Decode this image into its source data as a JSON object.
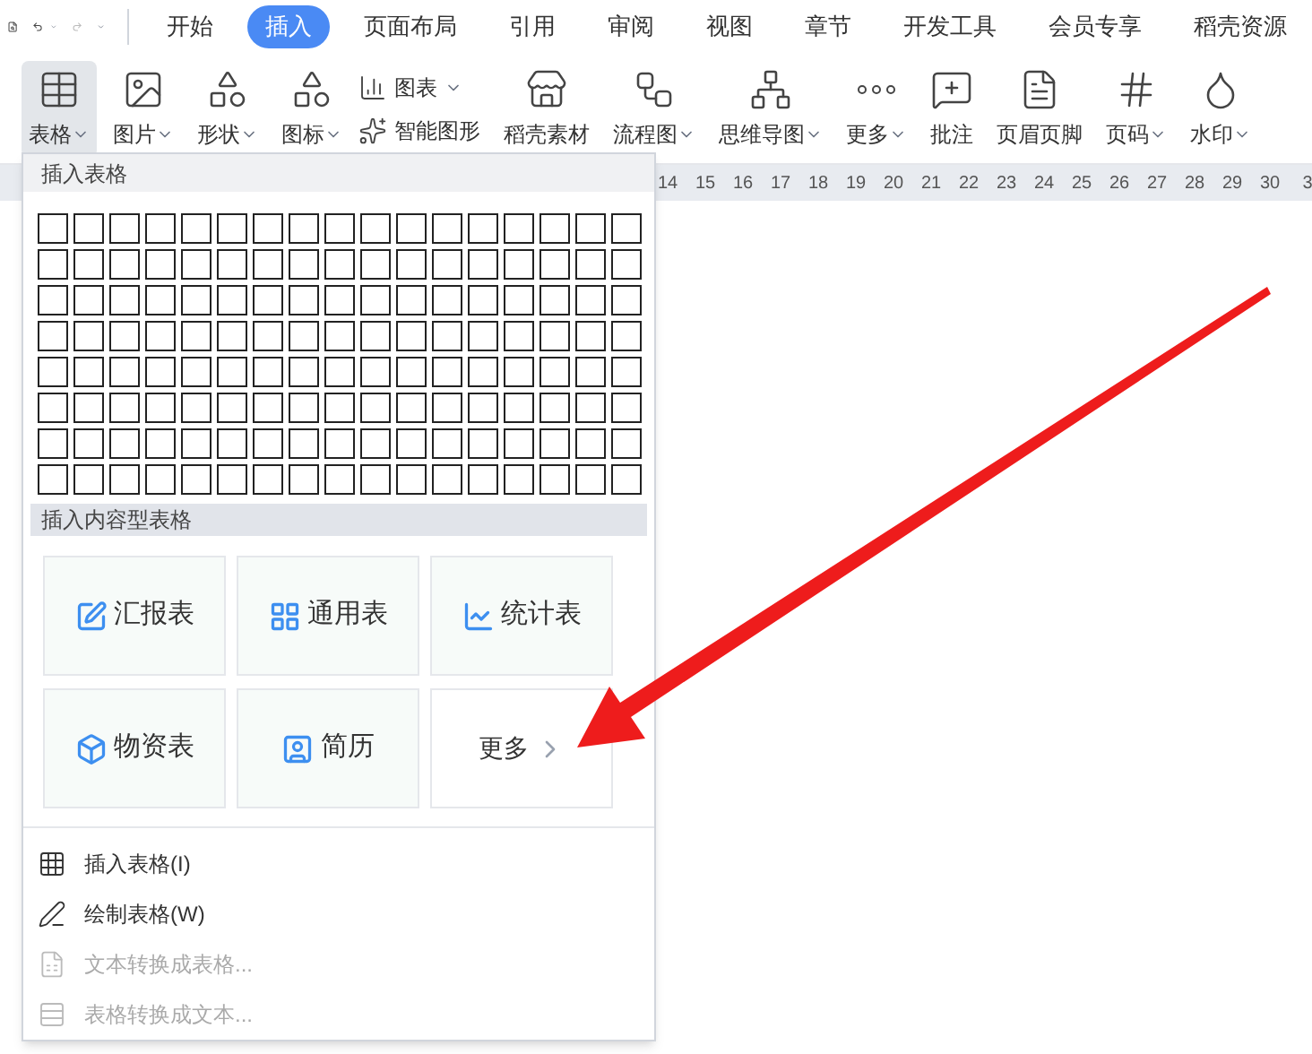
{
  "tabs": [
    {
      "label": "开始",
      "selected": false
    },
    {
      "label": "插入",
      "selected": true
    },
    {
      "label": "页面布局",
      "selected": false
    },
    {
      "label": "引用",
      "selected": false
    },
    {
      "label": "审阅",
      "selected": false
    },
    {
      "label": "视图",
      "selected": false
    },
    {
      "label": "章节",
      "selected": false
    },
    {
      "label": "开发工具",
      "selected": false
    },
    {
      "label": "会员专享",
      "selected": false
    },
    {
      "label": "稻壳资源",
      "selected": false
    }
  ],
  "ribbon": [
    {
      "kind": "table",
      "label": "表格",
      "caret": true,
      "selected": true
    },
    {
      "kind": "image",
      "label": "图片",
      "caret": true,
      "selected": false
    },
    {
      "kind": "shape",
      "label": "形状",
      "caret": true,
      "selected": false
    },
    {
      "kind": "icons",
      "label": "图标",
      "caret": true,
      "selected": false
    },
    {
      "kind": "stack",
      "items": [
        {
          "kind": "chart",
          "label": "图表",
          "caret": true
        },
        {
          "kind": "smart",
          "label": "智能图形",
          "caret": false
        }
      ]
    },
    {
      "kind": "store",
      "label": "稻壳素材",
      "caret": false,
      "selected": false
    },
    {
      "kind": "flow",
      "label": "流程图",
      "caret": true,
      "selected": false
    },
    {
      "kind": "mind",
      "label": "思维导图",
      "caret": true,
      "selected": false
    },
    {
      "kind": "more",
      "label": "更多",
      "caret": true,
      "selected": false
    },
    {
      "kind": "comment",
      "label": "批注",
      "caret": false,
      "selected": false
    },
    {
      "kind": "header",
      "label": "页眉页脚",
      "caret": false,
      "selected": false
    },
    {
      "kind": "pagenum",
      "label": "页码",
      "caret": true,
      "selected": false
    },
    {
      "kind": "watermark",
      "label": "水印",
      "caret": true,
      "selected": false
    }
  ],
  "ruler": [
    "14",
    "15",
    "16",
    "17",
    "18",
    "19",
    "20",
    "21",
    "22",
    "23",
    "24",
    "25",
    "26",
    "27",
    "28",
    "29",
    "30",
    "3"
  ],
  "menu": {
    "title": "插入表格",
    "section_title": "插入内容型表格",
    "templates": [
      {
        "kind": "report",
        "label": "汇报表"
      },
      {
        "kind": "general",
        "label": "通用表"
      },
      {
        "kind": "stats",
        "label": "统计表"
      },
      {
        "kind": "supplies",
        "label": "物资表"
      },
      {
        "kind": "resume",
        "label": "简历"
      },
      {
        "kind": "more",
        "label": "更多"
      }
    ],
    "items": [
      {
        "kind": "insert",
        "label": "插入表格(I)",
        "disabled": false
      },
      {
        "kind": "draw",
        "label": "绘制表格(W)",
        "disabled": false
      },
      {
        "kind": "text2table",
        "label": "文本转换成表格...",
        "disabled": true
      },
      {
        "kind": "table2text",
        "label": "表格转换成文本...",
        "disabled": true
      }
    ]
  }
}
